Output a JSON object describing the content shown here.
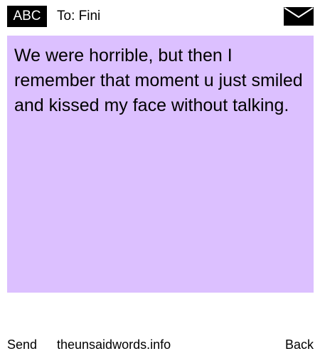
{
  "header": {
    "mode_label": "ABC",
    "recipient": "To: Fini",
    "icon": "envelope-icon"
  },
  "message": {
    "text": "We were horrible, but then I remember that moment u just smiled and kissed my face without talking.",
    "background_color": "#dcc0ff"
  },
  "footer": {
    "send_label": "Send",
    "site_label": "theunsaidwords.info",
    "back_label": "Back"
  }
}
